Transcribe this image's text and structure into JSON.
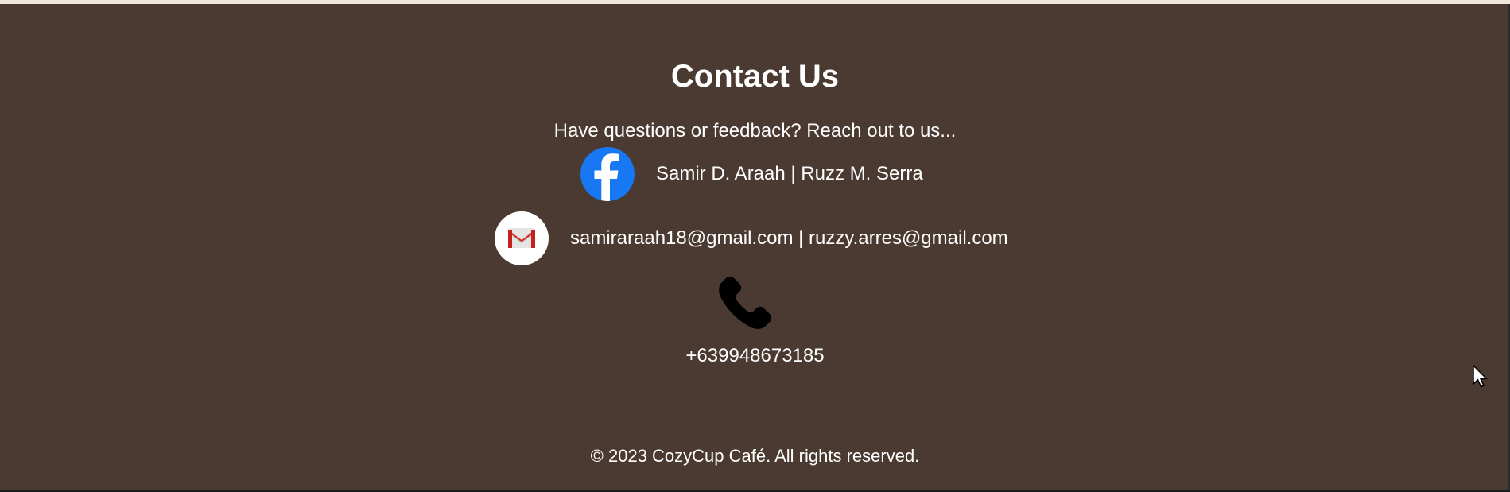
{
  "contact": {
    "title": "Contact Us",
    "subtitle": "Have questions or feedback? Reach out to us...",
    "facebook": {
      "icon": "facebook-icon",
      "text": "Samir D. Araah | Ruzz M. Serra"
    },
    "email": {
      "icon": "gmail-icon",
      "text": "samiraraah18@gmail.com | ruzzy.arres@gmail.com"
    },
    "phone": {
      "icon": "phone-icon",
      "number": "+639948673185"
    }
  },
  "footer": {
    "copyright": "© 2023 CozyCup Café. All rights reserved."
  },
  "colors": {
    "background": "#4a3a31",
    "text": "#ffffff",
    "facebook_blue": "#1877f2",
    "gmail_red": "#d93025"
  }
}
